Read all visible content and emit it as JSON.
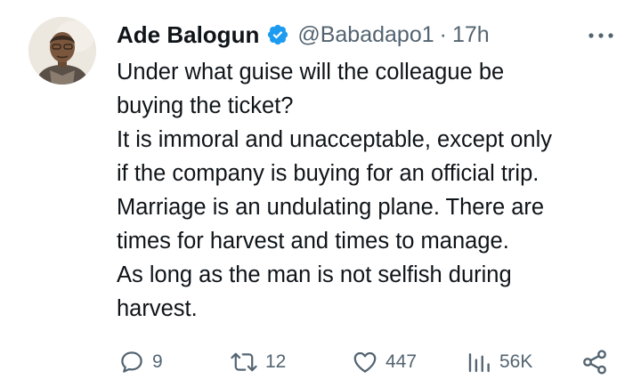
{
  "tweet": {
    "author_name": "Ade Balogun",
    "handle": "@Babadapo1",
    "separator": "·",
    "time": "17h",
    "text_lines": [
      "Under what guise will the colleague be",
      "buying the ticket?",
      "It is immoral and unacceptable, except only",
      "if the company is buying for an official trip.",
      "Marriage is an undulating plane. There are",
      "times for harvest and times to manage.",
      "As long as the man is not selfish during",
      "harvest."
    ]
  },
  "actions": {
    "replies": "9",
    "reposts": "12",
    "likes": "447",
    "views": "56K"
  },
  "icons": {
    "verified": "verified-badge-icon",
    "more": "more-options-icon",
    "reply": "reply-icon",
    "repost": "repost-icon",
    "like": "heart-icon",
    "views": "views-chart-icon",
    "share": "share-icon"
  },
  "colors": {
    "text": "#0f1419",
    "secondary": "#536471",
    "verified": "#1d9bf0"
  }
}
